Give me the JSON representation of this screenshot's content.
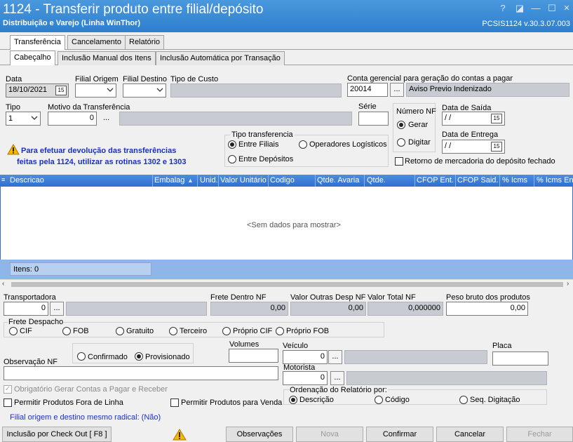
{
  "window": {
    "title": "1124 - Transferir produto entre filial/depósito",
    "subtitle": "Distribuição e Varejo (Linha WinThor)",
    "version": "PCSIS1124  v.30.3.07.003",
    "btn_help": "?",
    "btn_restore": "◪",
    "btn_min": "—",
    "btn_max": "☐"
  },
  "tabs": {
    "main": [
      "Transferência",
      "Cancelamento",
      "Relatório"
    ],
    "sub": [
      "Cabeçalho",
      "Inclusão Manual dos Itens",
      "Inclusão Automática por Transação"
    ]
  },
  "form": {
    "data_label": "Data",
    "data_value": "18/10/2021",
    "filial_origem_label": "Filial Origem",
    "filial_destino_label": "Filial Destino",
    "tipo_custo_label": "Tipo de Custo",
    "conta_label": "Conta gerencial para geração do contas a pagar",
    "conta_value": "20014",
    "conta_desc": "Aviso Previo Indenizado",
    "tipo_label": "Tipo",
    "tipo_value": "1",
    "motivo_label": "Motivo da Transferência",
    "motivo_value": "0",
    "serie_label": "Série",
    "numero_nf_label": "Número NF",
    "gerar_label": "Gerar",
    "digitar_label": "Digitar",
    "data_saida_label": "Data de Saída",
    "data_saida_value": "/ /",
    "data_entrega_label": "Data de Entrega",
    "data_entrega_value": "/ /",
    "retorno_label": "Retorno de mercadoria do depósito fechado",
    "tipo_transf_label": "Tipo transferencia",
    "entre_filiais": "Entre Filiais",
    "operadores": "Operadores Logísticos",
    "entre_depositos": "Entre Depósitos",
    "warning_line1": "Para efetuar devolução das transferências",
    "warning_line2": "feitas pela 1124, utilizar as rotinas 1302 e 1303",
    "ellipsis": "...",
    "cal_icon": "15"
  },
  "grid": {
    "columns": [
      "Descricao",
      "Embalage",
      "Unid.",
      "Valor Unitário",
      "Codigo",
      "Qtde. Avaria",
      "Qtde.",
      "CFOP Ent.",
      "CFOP Said.",
      "% Icms",
      "% Icms Ent"
    ],
    "empty": "<Sem dados para mostrar>",
    "itens": "Itens: 0"
  },
  "frete": {
    "transportadora_label": "Transportadora",
    "transportadora_value": "0",
    "frete_dentro_label": "Frete Dentro NF",
    "frete_dentro_value": "0,00",
    "valor_outras_label": "Valor Outras Desp NF",
    "valor_outras_value": "0,00",
    "valor_total_label": "Valor Total NF",
    "valor_total_value": "0,000000",
    "peso_label": "Peso bruto dos produtos",
    "peso_value": "0,00",
    "despacho_label": "Frete Despacho",
    "despacho_options": [
      "CIF",
      "FOB",
      "Gratuito",
      "Terceiro",
      "Próprio CIF",
      "Próprio FOB"
    ],
    "confirmado": "Confirmado",
    "provisionado": "Provisionado",
    "volumes_label": "Volumes",
    "veiculo_label": "Veículo",
    "veiculo_value": "0",
    "placa_label": "Placa",
    "motorista_label": "Motorista",
    "motorista_value": "0",
    "obs_label": "Observação NF",
    "obrig_label": "Obrigatório Gerar Contas a Pagar e Receber",
    "fora_linha_label": "Permitir Produtos Fora de Linha",
    "para_venda_label": "Permitir Produtos para Venda",
    "ordenacao_label": "Ordenação do Relatório por:",
    "ord_options": [
      "Descrição",
      "Código",
      "Seq. Digitação"
    ],
    "radical_text": "Filial origem e destino mesmo radical: (Não)"
  },
  "buttons": {
    "checkout": "Inclusão por Check Out  [ F8 ]",
    "observacoes": "Observações",
    "nova": "Nova",
    "confirmar": "Confirmar",
    "cancelar": "Cancelar",
    "fechar": "Fechar"
  }
}
